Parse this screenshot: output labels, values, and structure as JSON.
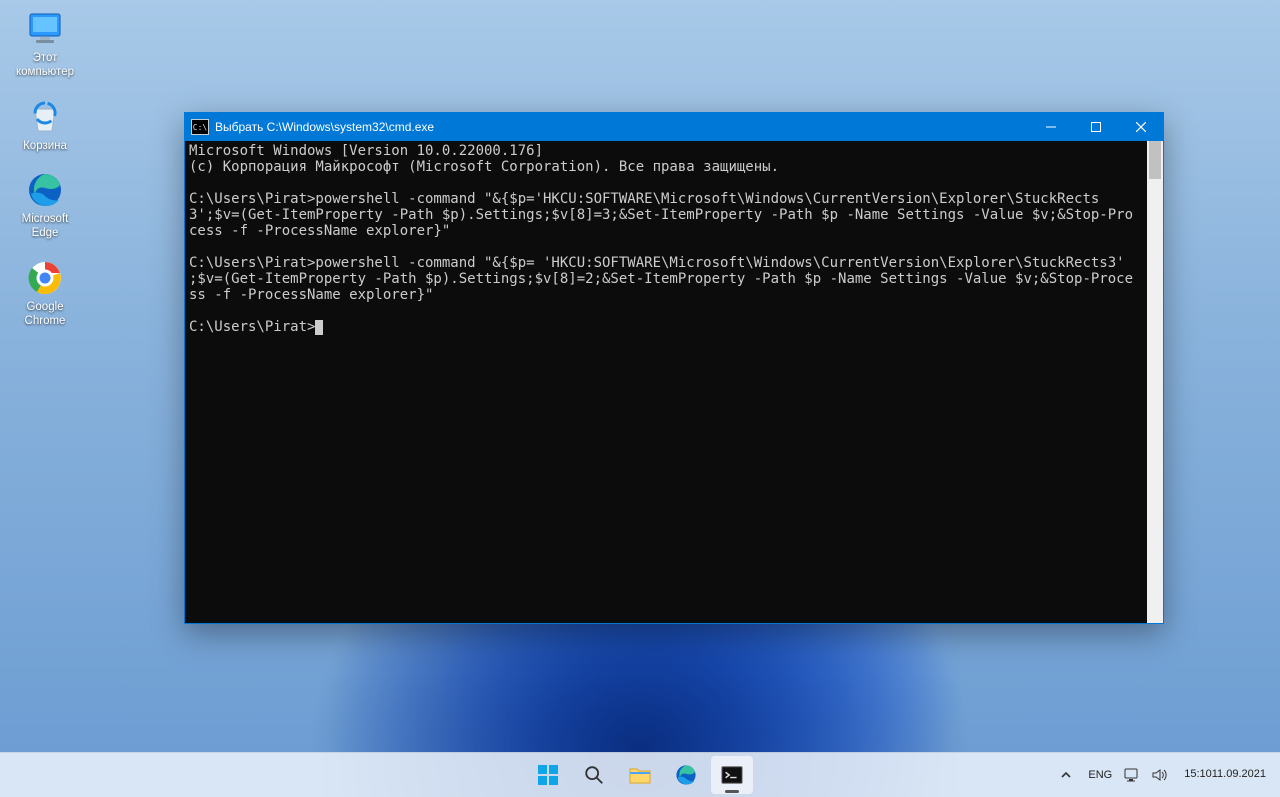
{
  "desktop": {
    "icons": [
      {
        "name": "this-pc",
        "label": "Этот\nкомпьютер"
      },
      {
        "name": "recycle-bin",
        "label": "Корзина"
      },
      {
        "name": "edge",
        "label": "Microsoft\nEdge"
      },
      {
        "name": "chrome",
        "label": "Google\nChrome"
      }
    ]
  },
  "cmd": {
    "title": "Выбрать C:\\Windows\\system32\\cmd.exe",
    "icon_text": "C:\\",
    "lines": [
      "Microsoft Windows [Version 10.0.22000.176]",
      "(c) Корпорация Майкрософт (Microsoft Corporation). Все права защищены.",
      "",
      "C:\\Users\\Pirat>powershell -command \"&{$p='HKCU:SOFTWARE\\Microsoft\\Windows\\CurrentVersion\\Explorer\\StuckRects3';$v=(Get-ItemProperty -Path $p).Settings;$v[8]=3;&Set-ItemProperty -Path $p -Name Settings -Value $v;&Stop-Process -f -ProcessName explorer}\"",
      "",
      "C:\\Users\\Pirat>powershell -command \"&{$p= 'HKCU:SOFTWARE\\Microsoft\\Windows\\CurrentVersion\\Explorer\\StuckRects3' ;$v=(Get-ItemProperty -Path $p).Settings;$v[8]=2;&Set-ItemProperty -Path $p -Name Settings -Value $v;&Stop-Process -f -ProcessName explorer}\"",
      ""
    ],
    "prompt": "C:\\Users\\Pirat>"
  },
  "taskbar": {
    "items": [
      {
        "name": "start",
        "active": false
      },
      {
        "name": "search",
        "active": false
      },
      {
        "name": "file-explorer",
        "active": false
      },
      {
        "name": "edge",
        "active": false
      },
      {
        "name": "cmd",
        "active": true
      }
    ],
    "tray": {
      "lang": "ENG",
      "time": "15:10",
      "date": "11.09.2021"
    }
  }
}
